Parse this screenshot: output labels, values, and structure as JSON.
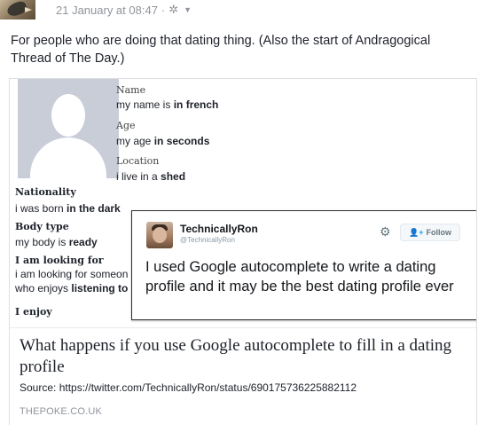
{
  "post": {
    "timestamp": "21 January at 08:47",
    "separator": "·",
    "privacy_icon": "gear-icon",
    "text": "For people who are doing that dating thing. (Also the start of Andragogical Thread of The Day.)"
  },
  "profile": {
    "name_label": "Name",
    "name_value": "my name is",
    "name_bold": "in french",
    "age_label": "Age",
    "age_value": "my age",
    "age_bold": "in seconds",
    "location_label": "Location",
    "location_value": "i live in a",
    "location_bold": "shed",
    "nationality_label": "Nationality",
    "nationality_value": "i was born",
    "nationality_bold": "in the dark",
    "body_label": "Body type",
    "body_value": "my body is",
    "body_bold": "ready",
    "looking_label": "I am looking for",
    "looking_value_1": "i am looking for someon",
    "looking_value_2a": "who enjoys",
    "looking_value_2b": "listening to",
    "enjoy_label": "I enjoy"
  },
  "tweet": {
    "name": "TechnicallyRon",
    "handle": "@TechnicallyRon",
    "follow_label": "Follow",
    "text": "I used Google autocomplete to write a dating profile and it may be the best dating profile ever"
  },
  "link": {
    "title": "What happens if you use Google autocomplete to fill in a dating profile",
    "source": "Source: https://twitter.com/TechnicallyRon/status/690175736225882112",
    "domain": "THEPOKE.CO.UK"
  }
}
